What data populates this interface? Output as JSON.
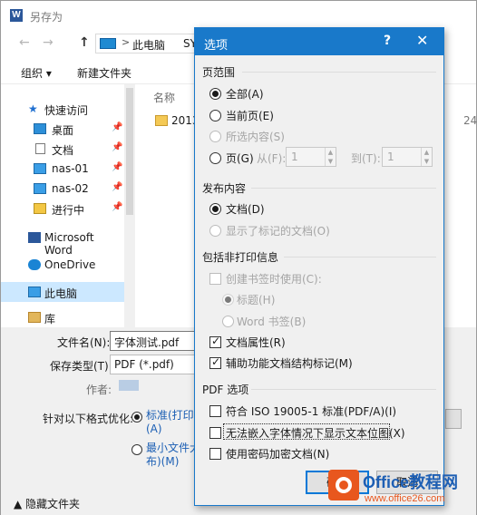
{
  "saveas": {
    "title": "另存为",
    "nav_back": "←",
    "nav_forward": "→",
    "nav_up": "↑",
    "address_sep": ">",
    "address_pc": "此电脑",
    "address_sys": "SYS",
    "toolbar_organize": "组织 ▾",
    "toolbar_new_folder": "新建文件夹",
    "nav_items": [
      {
        "label": "快速访问",
        "icon": "star-icon",
        "pinned": false
      },
      {
        "label": "桌面",
        "icon": "desktop-icon",
        "pinned": true
      },
      {
        "label": "文档",
        "icon": "document-icon",
        "pinned": true
      },
      {
        "label": "nas-01",
        "icon": "monitor-icon",
        "pinned": true
      },
      {
        "label": "nas-02",
        "icon": "monitor-icon",
        "pinned": true
      },
      {
        "label": "进行中",
        "icon": "folder-icon",
        "pinned": true
      },
      {
        "label": "Microsoft Word",
        "icon": "word-icon",
        "pinned": false
      },
      {
        "label": "OneDrive",
        "icon": "cloud-icon",
        "pinned": false
      },
      {
        "label": "此电脑",
        "icon": "computer-icon",
        "pinned": false
      },
      {
        "label": "库",
        "icon": "library-icon",
        "pinned": false
      }
    ],
    "pin_glyph": "📌",
    "column_name": "名称",
    "folder_name": "2013",
    "right_number": "24",
    "filename_label": "文件名(N):",
    "filename_value": "字体测试.pdf",
    "filetype_label": "保存类型(T):",
    "filetype_value": "PDF (*.pdf)",
    "author_label": "作者:",
    "optimize_label": "针对以下格式优化:",
    "optimize_standard_line1": "标准(打印和",
    "optimize_standard_line2": "(A)",
    "optimize_min_line1": "最小文件大",
    "optimize_min_line2": "布)(M)",
    "hide_folders": "▲ 隐藏文件夹"
  },
  "options": {
    "title": "选项",
    "help": "?",
    "close": "✕",
    "page_range": {
      "label": "页范围",
      "all": "全部(A)",
      "current": "当前页(E)",
      "selection": "所选内容(S)",
      "pages": "页(G)",
      "from_label": "从(F):",
      "from_value": "1",
      "to_label": "到(T):",
      "to_value": "1"
    },
    "publish": {
      "label": "发布内容",
      "document": "文档(D)",
      "markup": "显示了标记的文档(O)"
    },
    "non_print": {
      "label": "包括非打印信息",
      "create_bookmarks": "创建书签时使用(C):",
      "headings": "标题(H)",
      "word_bookmarks": "Word 书签(B)",
      "doc_props": "文档属性(R)",
      "structure_tags": "辅助功能文档结构标记(M)"
    },
    "pdf": {
      "label": "PDF 选项",
      "iso": "符合 ISO 19005-1 标准(PDF/A)(I)",
      "bitmap": "无法嵌入字体情况下显示文本位图(X)",
      "encrypt": "使用密码加密文档(N)"
    },
    "ok_label": "确定",
    "cancel_label": "取消"
  },
  "watermark": {
    "brand": "Office教程网",
    "url": "www.office26.com"
  },
  "colors": {
    "accent": "#1979ca",
    "selection": "#cce8ff",
    "watermark_orange": "#e8571e",
    "watermark_blue": "#1e5fb4"
  }
}
